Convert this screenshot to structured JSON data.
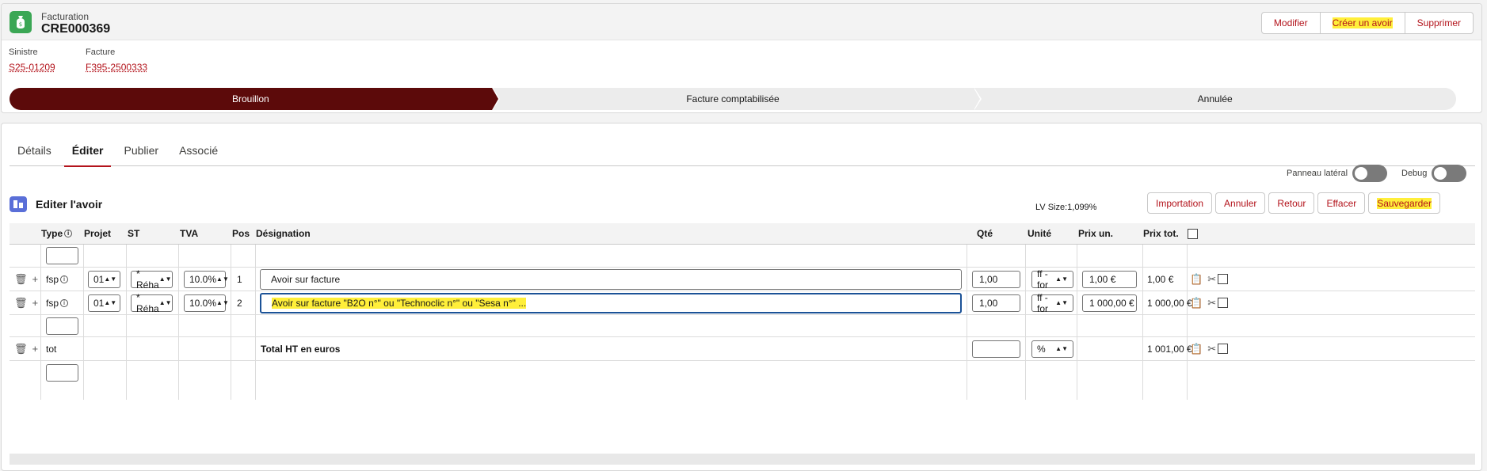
{
  "header": {
    "object_type": "Facturation",
    "object_name": "CRE000369",
    "buttons": [
      "Modifier",
      "Créer un avoir",
      "Supprimer"
    ],
    "fields": [
      {
        "label": "Sinistre",
        "value": "S25-01209"
      },
      {
        "label": "Facture",
        "value": "F395-2500333"
      }
    ],
    "path": [
      "Brouillon",
      "Facture comptabilisée",
      "Annulée"
    ]
  },
  "tabs": [
    "Détails",
    "Éditer",
    "Publier",
    "Associé"
  ],
  "toggles": {
    "side_panel": "Panneau latéral",
    "debug": "Debug"
  },
  "section": {
    "title": "Editer l'avoir",
    "lv_size": "LV Size:1,099%",
    "actions": [
      "Importation",
      "Annuler",
      "Retour",
      "Effacer",
      "Sauvegarder"
    ]
  },
  "table": {
    "headers": {
      "type": "Type",
      "projet": "Projet",
      "st": "ST",
      "tva": "TVA",
      "pos": "Pos",
      "designation": "Désignation",
      "qte": "Qté",
      "unite": "Unité",
      "prix_un": "Prix un.",
      "prix_tot": "Prix tot."
    },
    "rows": [
      {
        "type": "fsp",
        "projet": "01",
        "st": "* Réha",
        "tva": "10.0%",
        "pos": "1",
        "designation": "Avoir sur facture",
        "qte": "1,00",
        "unite": "ff - for",
        "prix_un": "1,00 €",
        "prix_tot": "1,00 €"
      },
      {
        "type": "fsp",
        "projet": "01",
        "st": "* Réha",
        "tva": "10.0%",
        "pos": "2",
        "designation": "Avoir sur facture \"B2O n°\" ou \"Technoclic n°\" ou \"Sesa n°\" ...",
        "qte": "1,00",
        "unite": "ff - for",
        "prix_un": "1 000,00 €",
        "prix_tot": "1 000,00 €"
      }
    ],
    "total": {
      "type": "tot",
      "designation": "Total HT en euros",
      "unite": "%",
      "prix_tot": "1 001,00 €"
    }
  },
  "colors": {
    "accent": "#b3131b",
    "path_active": "#5c0a0a",
    "highlight": "#ffef3a",
    "app_icon": "#3ba755"
  },
  "icons": [
    "money-bag-icon",
    "trash-icon",
    "plus-icon",
    "info-icon",
    "clipboard-icon",
    "scissors-icon",
    "list-icon"
  ]
}
